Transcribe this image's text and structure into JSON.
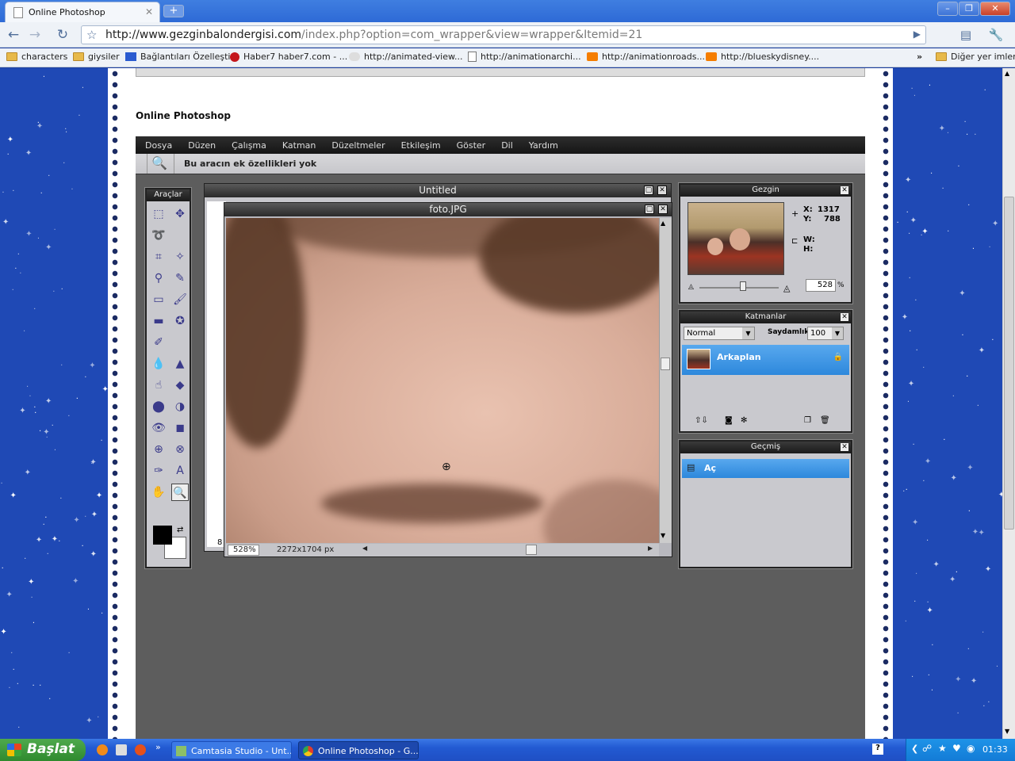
{
  "browser": {
    "tab_title": "Online Photoshop",
    "new_tab": "+",
    "window_controls": [
      "–",
      "❐",
      "✕"
    ],
    "url_host": "http://www.gezginbalondergisi.com",
    "url_path": "/index.php?option=com_wrapper&view=wrapper&Itemid=21",
    "bookmarks": [
      {
        "label": "characters",
        "icon": "folder-icon"
      },
      {
        "label": "giysiler",
        "icon": "folder-icon"
      },
      {
        "label": "Bağlantıları Özelleştir",
        "icon": "m-icon"
      },
      {
        "label": "Haber7 haber7.com - ...",
        "icon": "haber7-icon"
      },
      {
        "label": "http://animated-view...",
        "icon": "cloud-icon"
      },
      {
        "label": "http://animationarchi...",
        "icon": "page-icon"
      },
      {
        "label": "http://animationroads...",
        "icon": "blogger-icon"
      },
      {
        "label": "http://blueskydisney....",
        "icon": "blogger-icon"
      }
    ],
    "bookmarks_more": "»",
    "other_bookmarks": "Diğer yer imleri"
  },
  "site": {
    "title": "Online Photoshop"
  },
  "editor": {
    "menu": [
      "Dosya",
      "Düzen",
      "Çalışma",
      "Katman",
      "Düzeltmeler",
      "Etkileşim",
      "Göster",
      "Dil",
      "Yardım"
    ],
    "options_text": "Bu aracın ek özellikleri yok",
    "tools_title": "Araçlar",
    "back_window_title": "Untitled",
    "back_window_zoom_peek": "8",
    "image_window_title": "foto.JPG",
    "zoom": "528%",
    "image_size": "2272x1704 px",
    "navigator": {
      "title": "Gezgin",
      "x_label": "X:",
      "x_value": "1317",
      "y_label": "Y:",
      "y_value": "788",
      "w_label": "W:",
      "h_label": "H:",
      "zoom_value": "528",
      "zoom_unit": "%",
      "zoom_slider_fraction": 0.55
    },
    "layers": {
      "title": "Katmanlar",
      "blend_mode": "Normal",
      "opacity_label": "Saydamlık:",
      "opacity_value": "100",
      "layer_name": "Arkaplan"
    },
    "history": {
      "title": "Geçmiş",
      "item": "Aç"
    }
  },
  "taskbar": {
    "start_label": "Başlat",
    "tasks": [
      "Camtasia Studio - Unt...",
      "Online Photoshop - G..."
    ],
    "clock": "01:33"
  }
}
